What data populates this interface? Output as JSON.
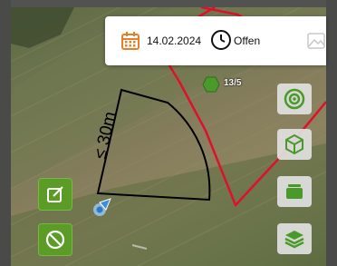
{
  "info_bar": {
    "date": "14.02.2024",
    "status": "Offen"
  },
  "map": {
    "distance_label": "≤ 30m",
    "hex_count": "13/5"
  },
  "icons": {
    "calendar": "calendar-icon",
    "clock": "clock-icon",
    "image": "image-placeholder-icon",
    "target": "target-icon",
    "cube": "cube-icon",
    "folder": "folder-icon",
    "layers": "layers-icon",
    "edit": "edit-icon",
    "cancel": "cancel-icon",
    "hexagon": "hexagon-icon",
    "location": "location-marker-icon"
  },
  "colors": {
    "field_boundary": "#e0102a",
    "accent_green": "#4a9a2a",
    "calendar_orange": "#e77e2a"
  }
}
